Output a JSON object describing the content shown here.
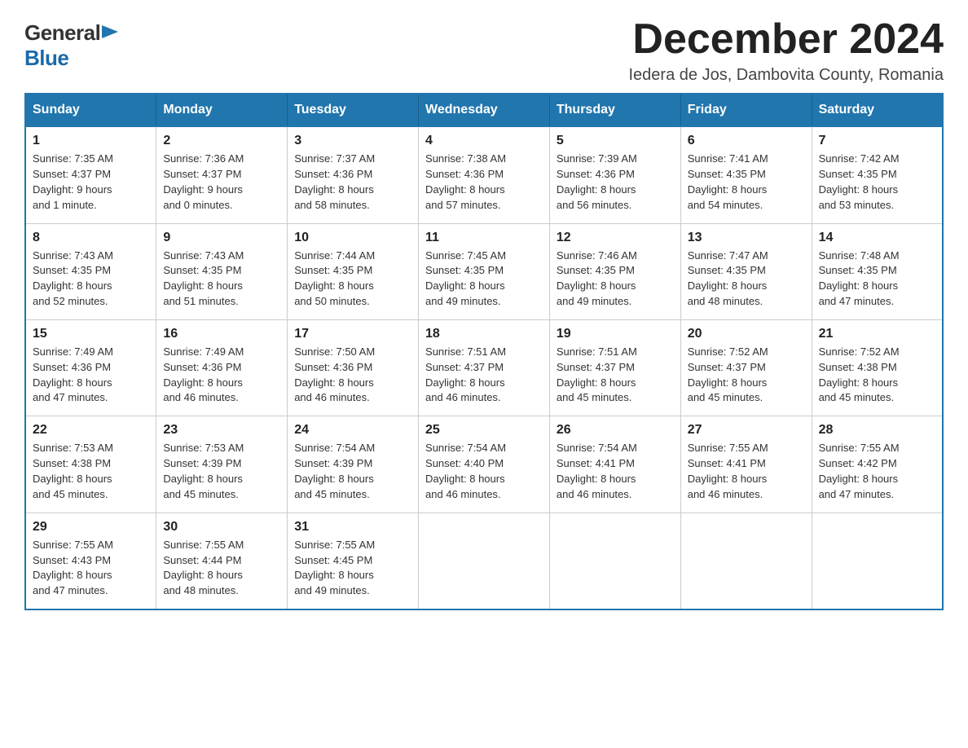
{
  "logo": {
    "general": "General",
    "blue": "Blue"
  },
  "title": "December 2024",
  "location": "Iedera de Jos, Dambovita County, Romania",
  "days_of_week": [
    "Sunday",
    "Monday",
    "Tuesday",
    "Wednesday",
    "Thursday",
    "Friday",
    "Saturday"
  ],
  "weeks": [
    [
      {
        "day": "1",
        "sunrise": "7:35 AM",
        "sunset": "4:37 PM",
        "daylight": "9 hours and 1 minute."
      },
      {
        "day": "2",
        "sunrise": "7:36 AM",
        "sunset": "4:37 PM",
        "daylight": "9 hours and 0 minutes."
      },
      {
        "day": "3",
        "sunrise": "7:37 AM",
        "sunset": "4:36 PM",
        "daylight": "8 hours and 58 minutes."
      },
      {
        "day": "4",
        "sunrise": "7:38 AM",
        "sunset": "4:36 PM",
        "daylight": "8 hours and 57 minutes."
      },
      {
        "day": "5",
        "sunrise": "7:39 AM",
        "sunset": "4:36 PM",
        "daylight": "8 hours and 56 minutes."
      },
      {
        "day": "6",
        "sunrise": "7:41 AM",
        "sunset": "4:35 PM",
        "daylight": "8 hours and 54 minutes."
      },
      {
        "day": "7",
        "sunrise": "7:42 AM",
        "sunset": "4:35 PM",
        "daylight": "8 hours and 53 minutes."
      }
    ],
    [
      {
        "day": "8",
        "sunrise": "7:43 AM",
        "sunset": "4:35 PM",
        "daylight": "8 hours and 52 minutes."
      },
      {
        "day": "9",
        "sunrise": "7:43 AM",
        "sunset": "4:35 PM",
        "daylight": "8 hours and 51 minutes."
      },
      {
        "day": "10",
        "sunrise": "7:44 AM",
        "sunset": "4:35 PM",
        "daylight": "8 hours and 50 minutes."
      },
      {
        "day": "11",
        "sunrise": "7:45 AM",
        "sunset": "4:35 PM",
        "daylight": "8 hours and 49 minutes."
      },
      {
        "day": "12",
        "sunrise": "7:46 AM",
        "sunset": "4:35 PM",
        "daylight": "8 hours and 49 minutes."
      },
      {
        "day": "13",
        "sunrise": "7:47 AM",
        "sunset": "4:35 PM",
        "daylight": "8 hours and 48 minutes."
      },
      {
        "day": "14",
        "sunrise": "7:48 AM",
        "sunset": "4:35 PM",
        "daylight": "8 hours and 47 minutes."
      }
    ],
    [
      {
        "day": "15",
        "sunrise": "7:49 AM",
        "sunset": "4:36 PM",
        "daylight": "8 hours and 47 minutes."
      },
      {
        "day": "16",
        "sunrise": "7:49 AM",
        "sunset": "4:36 PM",
        "daylight": "8 hours and 46 minutes."
      },
      {
        "day": "17",
        "sunrise": "7:50 AM",
        "sunset": "4:36 PM",
        "daylight": "8 hours and 46 minutes."
      },
      {
        "day": "18",
        "sunrise": "7:51 AM",
        "sunset": "4:37 PM",
        "daylight": "8 hours and 46 minutes."
      },
      {
        "day": "19",
        "sunrise": "7:51 AM",
        "sunset": "4:37 PM",
        "daylight": "8 hours and 45 minutes."
      },
      {
        "day": "20",
        "sunrise": "7:52 AM",
        "sunset": "4:37 PM",
        "daylight": "8 hours and 45 minutes."
      },
      {
        "day": "21",
        "sunrise": "7:52 AM",
        "sunset": "4:38 PM",
        "daylight": "8 hours and 45 minutes."
      }
    ],
    [
      {
        "day": "22",
        "sunrise": "7:53 AM",
        "sunset": "4:38 PM",
        "daylight": "8 hours and 45 minutes."
      },
      {
        "day": "23",
        "sunrise": "7:53 AM",
        "sunset": "4:39 PM",
        "daylight": "8 hours and 45 minutes."
      },
      {
        "day": "24",
        "sunrise": "7:54 AM",
        "sunset": "4:39 PM",
        "daylight": "8 hours and 45 minutes."
      },
      {
        "day": "25",
        "sunrise": "7:54 AM",
        "sunset": "4:40 PM",
        "daylight": "8 hours and 46 minutes."
      },
      {
        "day": "26",
        "sunrise": "7:54 AM",
        "sunset": "4:41 PM",
        "daylight": "8 hours and 46 minutes."
      },
      {
        "day": "27",
        "sunrise": "7:55 AM",
        "sunset": "4:41 PM",
        "daylight": "8 hours and 46 minutes."
      },
      {
        "day": "28",
        "sunrise": "7:55 AM",
        "sunset": "4:42 PM",
        "daylight": "8 hours and 47 minutes."
      }
    ],
    [
      {
        "day": "29",
        "sunrise": "7:55 AM",
        "sunset": "4:43 PM",
        "daylight": "8 hours and 47 minutes."
      },
      {
        "day": "30",
        "sunrise": "7:55 AM",
        "sunset": "4:44 PM",
        "daylight": "8 hours and 48 minutes."
      },
      {
        "day": "31",
        "sunrise": "7:55 AM",
        "sunset": "4:45 PM",
        "daylight": "8 hours and 49 minutes."
      },
      null,
      null,
      null,
      null
    ]
  ],
  "labels": {
    "sunrise": "Sunrise:",
    "sunset": "Sunset:",
    "daylight": "Daylight:"
  }
}
